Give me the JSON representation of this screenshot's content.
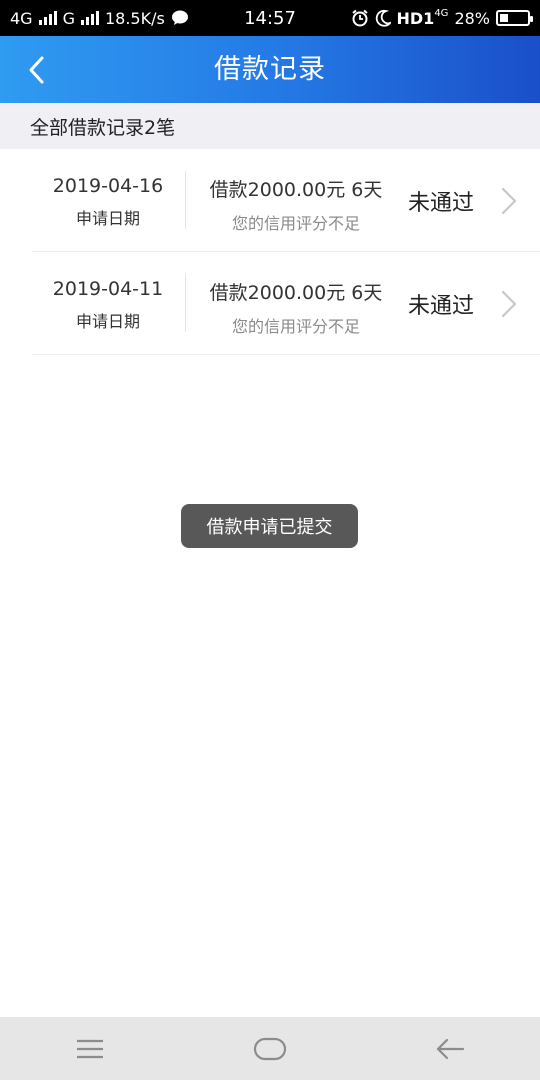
{
  "status_bar": {
    "network1": "4G",
    "network2": "G",
    "speed": "18.5K/s",
    "time": "14:57",
    "hd": "HD1",
    "net_small": "4G",
    "battery": "28%"
  },
  "header": {
    "title": "借款记录"
  },
  "summary": {
    "text": "全部借款记录2笔"
  },
  "records": [
    {
      "date": "2019-04-16",
      "date_label": "申请日期",
      "amount": "借款2000.00元 6天",
      "reason": "您的信用评分不足",
      "status": "未通过"
    },
    {
      "date": "2019-04-11",
      "date_label": "申请日期",
      "amount": "借款2000.00元 6天",
      "reason": "您的信用评分不足",
      "status": "未通过"
    }
  ],
  "toast": {
    "text": "借款申请已提交"
  },
  "icons": {
    "back": "back-chevron-icon",
    "row_arrow": "chevron-right-icon",
    "nav_menu": "menu-icon",
    "nav_home": "home-icon",
    "nav_back": "back-arrow-icon"
  },
  "colors": {
    "header_start": "#2f9bf1",
    "header_end": "#1a4fc9",
    "toast_bg": "#585858",
    "summary_bg": "#efeff4"
  }
}
